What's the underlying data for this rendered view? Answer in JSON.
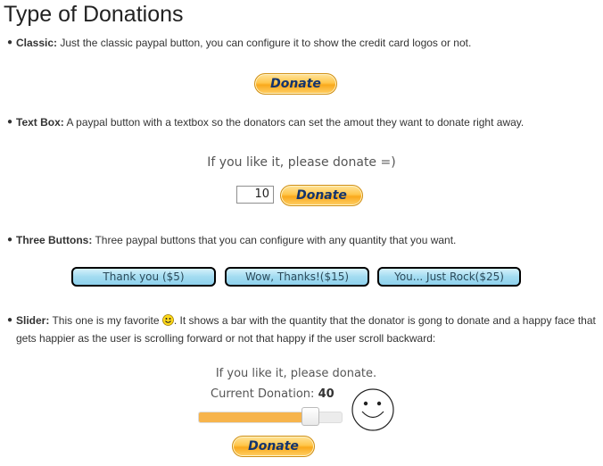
{
  "page": {
    "title": "Type of Donations"
  },
  "sections": {
    "classic": {
      "label": "Classic:",
      "description": " Just the classic paypal button, you can configure it to show the credit card logos or not.",
      "button": "Donate"
    },
    "textbox": {
      "label": "Text Box:",
      "description": " A paypal button with a textbox so the donators can set the amout they want to donate right away.",
      "prompt": "If you like it, please donate =)",
      "amount": "10",
      "button": "Donate"
    },
    "three_buttons": {
      "label": "Three Buttons:",
      "description": " Three paypal buttons that you can configure with any quantity that you want.",
      "buttons": [
        "Thank you ($5)",
        "Wow, Thanks!($15)",
        "You... Just Rock($25)"
      ]
    },
    "slider": {
      "label": "Slider:",
      "description_before_icon": " This one is my favorite ",
      "description_after_icon": ". It shows a bar with the quantity that the donator is gong to donate and a happy face that gets happier as the user is scrolling forward or not that happy if the user scroll backward:",
      "icon": "smiley-icon",
      "prompt": "If you like it, please donate.",
      "current_label": "Current Donation:",
      "current_value": "40",
      "slider_fraction": 0.8,
      "button": "Donate"
    }
  },
  "colors": {
    "donate_orange": "#ffc64a",
    "blue_button": "#a3dcf1",
    "slider_fill": "#f7b44c"
  }
}
